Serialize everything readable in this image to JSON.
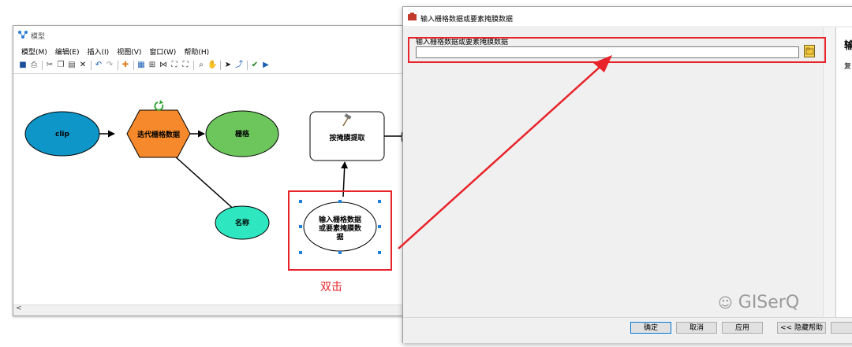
{
  "model_window": {
    "title": "模型",
    "menu": [
      "模型(M)",
      "编辑(E)",
      "插入(I)",
      "视图(V)",
      "窗口(W)",
      "帮助(H)"
    ],
    "nodes": {
      "clip": "clip",
      "iterator": "迭代栅格数据",
      "raster": "栅格",
      "name": "名称",
      "extract": "按掩膜提取",
      "input_line1": "输入栅格数据",
      "input_line2": "或要素掩膜数",
      "input_line3": "据"
    },
    "annotation": "双击",
    "scroll_left_glyph": "<"
  },
  "dialog": {
    "title": "输入栅格数据或要素掩膜数据",
    "field_label": "输入栅格数据或要素掩膜数据",
    "field_value": "",
    "help_title": "输",
    "help_text": "复",
    "buttons": {
      "ok": "确定",
      "cancel": "取消",
      "apply": "应用",
      "hide_help": "<< 隐藏帮助"
    }
  },
  "watermark": "GISerQ",
  "colors": {
    "clip": "#0e96c8",
    "iterator": "#f5892b",
    "raster": "#6cc65c",
    "name": "#2ee6c0",
    "highlight": "#e8232a",
    "selection_handle": "#1e7fd8"
  }
}
